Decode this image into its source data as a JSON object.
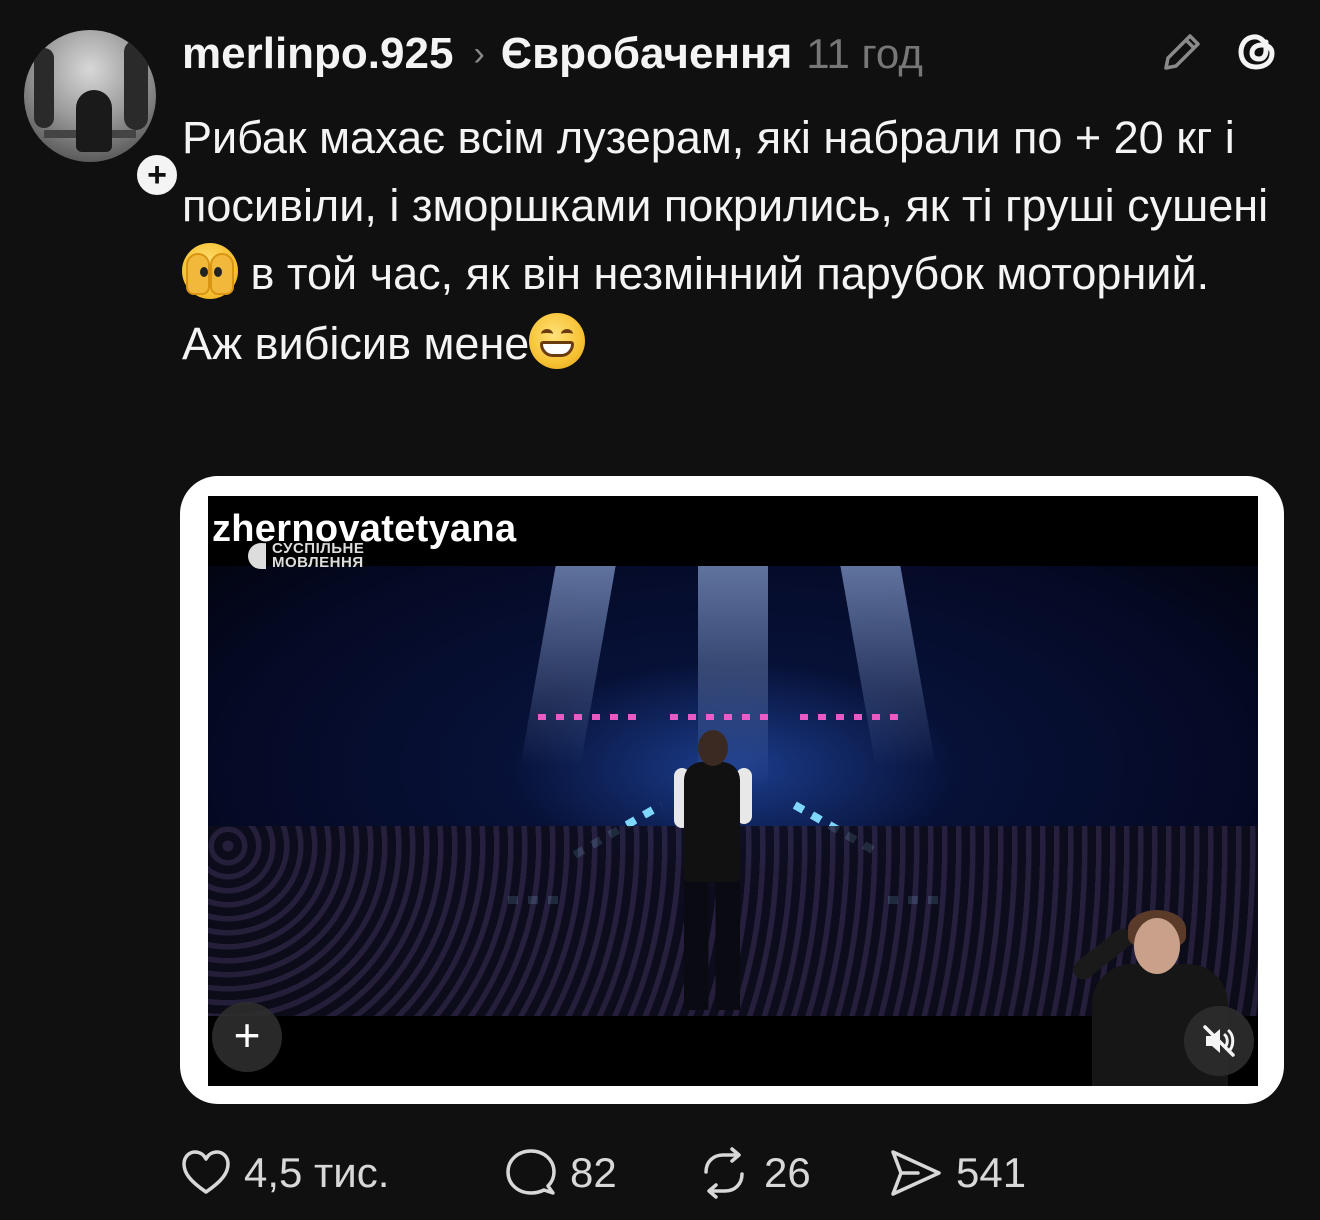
{
  "post": {
    "username": "merlinpo.925",
    "separator": "›",
    "topic": "Євробачення",
    "time": "11 год",
    "follow_symbol": "+",
    "text_line_1_before": "Рибак махає всім лузерам, які набрали по + 20 кг і посивіли, і зморшками покрились, як ті груші сушені",
    "text_line_1_after": " в той час, як він незмінний парубок моторний.",
    "text_line_2": "Аж вибісив мене",
    "emoji_1": "face-with-hands-over-eyes-emoji",
    "emoji_2": "grinning-face-emoji"
  },
  "media": {
    "watermark": "zhernovatetyana",
    "channel_logo_line_1": "СУСПІЛЬНЕ",
    "channel_logo_line_2": "МОВЛЕННЯ",
    "add_symbol": "+",
    "mute_icon": "speaker-muted-icon"
  },
  "actions": {
    "likes": "4,5 тис.",
    "replies": "82",
    "reposts": "26",
    "shares": "541"
  },
  "colors": {
    "background": "#101010",
    "text": "#f4f4f4",
    "muted": "#777777",
    "frame": "#ffffff"
  }
}
